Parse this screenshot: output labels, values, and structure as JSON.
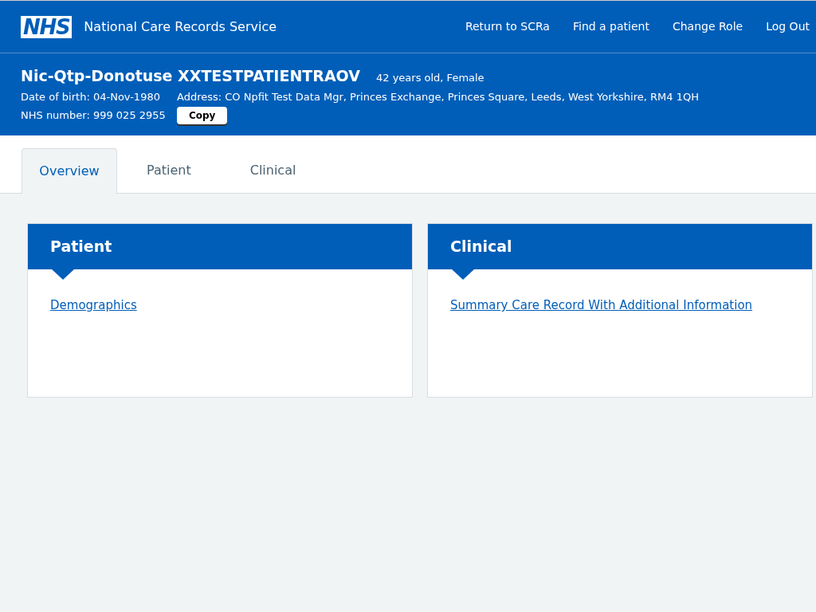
{
  "header": {
    "logo": "NHS",
    "service_name": "National Care Records Service",
    "nav": [
      "Return to SCRa",
      "Find a patient",
      "Change Role",
      "Log Out"
    ]
  },
  "patient": {
    "name": "Nic-Qtp-Donotuse XXTESTPATIENTRAOV",
    "age_sex": "42 years old, Female",
    "dob": "Date of birth: 04-Nov-1980",
    "address": "Address: CO Npfit Test Data Mgr, Princes Exchange, Princes Square, Leeds, West Yorkshire, RM4 1QH",
    "nhs_number": "NHS number: 999 025 2955",
    "copy_button": "Copy"
  },
  "tabs": [
    {
      "label": "Overview",
      "selected": true
    },
    {
      "label": "Patient",
      "selected": false
    },
    {
      "label": "Clinical",
      "selected": false
    }
  ],
  "cards": [
    {
      "title": "Patient",
      "links": [
        "Demographics"
      ]
    },
    {
      "title": "Clinical",
      "links": [
        "Summary Care Record With Additional Information"
      ]
    }
  ]
}
